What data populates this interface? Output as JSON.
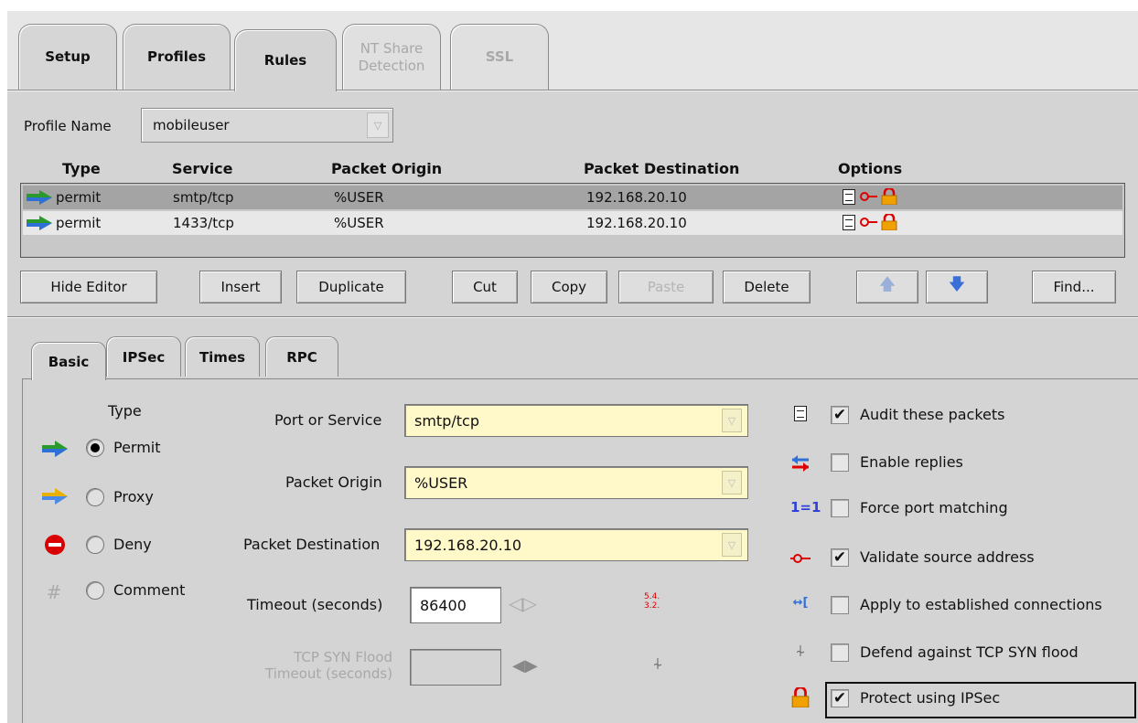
{
  "top_tabs": [
    {
      "label": "Setup"
    },
    {
      "label": "Profiles"
    },
    {
      "label": "Rules",
      "active": true
    },
    {
      "label_line1": "NT Share",
      "label_line2": "Detection",
      "disabled": true
    },
    {
      "label": "SSL",
      "disabled": true
    }
  ],
  "profile": {
    "label": "Profile Name",
    "value": "mobileuser"
  },
  "table": {
    "headers": [
      "Type",
      "Service",
      "Packet Origin",
      "Packet Destination",
      "Options"
    ],
    "rows": [
      {
        "type": "permit",
        "service": "smtp/tcp",
        "origin": "%USER",
        "destination": "192.168.20.10",
        "selected": true
      },
      {
        "type": "permit",
        "service": "1433/tcp",
        "origin": "%USER",
        "destination": "192.168.20.10",
        "selected": false
      }
    ]
  },
  "buttons": {
    "hide_editor": "Hide Editor",
    "insert": "Insert",
    "duplicate": "Duplicate",
    "cut": "Cut",
    "copy": "Copy",
    "paste": "Paste",
    "delete": "Delete",
    "find": "Find..."
  },
  "sub_tabs": [
    {
      "label": "Basic",
      "active": true
    },
    {
      "label": "IPSec"
    },
    {
      "label": "Times"
    },
    {
      "label": "RPC"
    }
  ],
  "type_group": {
    "title": "Type",
    "options": [
      "Permit",
      "Proxy",
      "Deny",
      "Comment"
    ],
    "selected": "Permit"
  },
  "form": {
    "port_label": "Port or Service",
    "port_value": "smtp/tcp",
    "origin_label": "Packet Origin",
    "origin_value": "%USER",
    "dest_label": "Packet Destination",
    "dest_value": "192.168.20.10",
    "timeout_label": "Timeout (seconds)",
    "timeout_value": "86400",
    "syn_label_line1": "TCP SYN Flood",
    "syn_label_line2": "Timeout (seconds)",
    "version_badge": "5.4. 3.2."
  },
  "checkboxes": [
    {
      "label": "Audit these packets",
      "checked": true,
      "icon": "document-icon"
    },
    {
      "label": "Enable replies",
      "checked": false,
      "icon": "bidirectional-arrows-icon"
    },
    {
      "label": "Force port matching",
      "checked": false,
      "icon": "port-match-icon"
    },
    {
      "label": "Validate source address",
      "checked": true,
      "icon": "validate-pin-icon"
    },
    {
      "label": "Apply to established connections",
      "checked": false,
      "icon": "established-connection-icon"
    },
    {
      "label": "Defend against TCP SYN flood",
      "checked": false,
      "icon": "syn-flood-icon"
    },
    {
      "label": "Protect using IPSec",
      "checked": true,
      "icon": "lock-icon"
    }
  ],
  "colors": {
    "accent_yellow": "#fff8c8",
    "panel": "#d4d4d4",
    "lock": "#f0a000",
    "red": "#d00000"
  }
}
